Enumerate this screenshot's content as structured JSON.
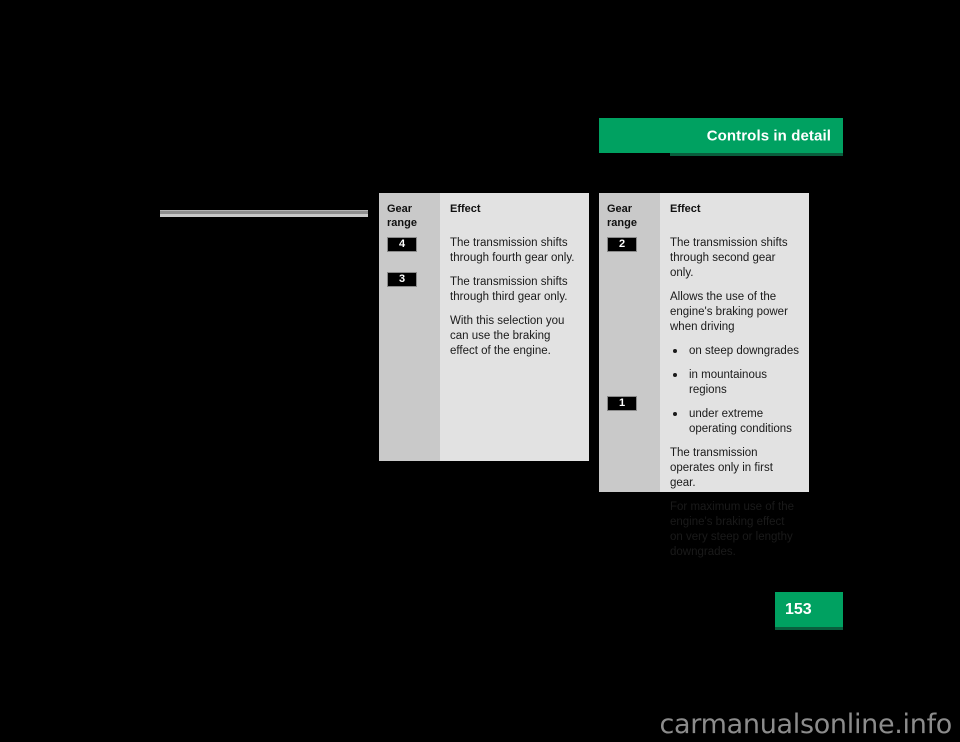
{
  "header": {
    "title": "Controls in detail"
  },
  "page": {
    "number": "153"
  },
  "watermark": {
    "text": "carmanualsonline.info"
  },
  "tables": [
    {
      "id": "left",
      "headers": {
        "gear_range": "Gear\nrange",
        "gear_range_line1": "Gear",
        "gear_range_line2": "range",
        "effect": "Effect"
      },
      "rows": [
        {
          "gear": "4",
          "paragraphs": [
            "The transmission shifts through fourth gear only."
          ]
        },
        {
          "gear": "3",
          "paragraphs": [
            "The transmission shifts through third gear only.",
            "With this selection you can use the braking effect of the engine."
          ]
        }
      ]
    },
    {
      "id": "right",
      "headers": {
        "gear_range_line1": "Gear",
        "gear_range_line2": "range",
        "effect": "Effect"
      },
      "rows": [
        {
          "gear": "2",
          "paragraphs": [
            "The transmission shifts through second gear only.",
            "Allows the use of the engine's braking power when driving"
          ],
          "bullets": [
            "on steep downgrades",
            "in mountainous regions",
            "under extreme operating conditions"
          ]
        },
        {
          "gear": "1",
          "paragraphs": [
            "The transmission operates only in first gear.",
            "For maximum use of the engine's braking effect on very steep or lengthy downgrades."
          ]
        }
      ]
    }
  ]
}
